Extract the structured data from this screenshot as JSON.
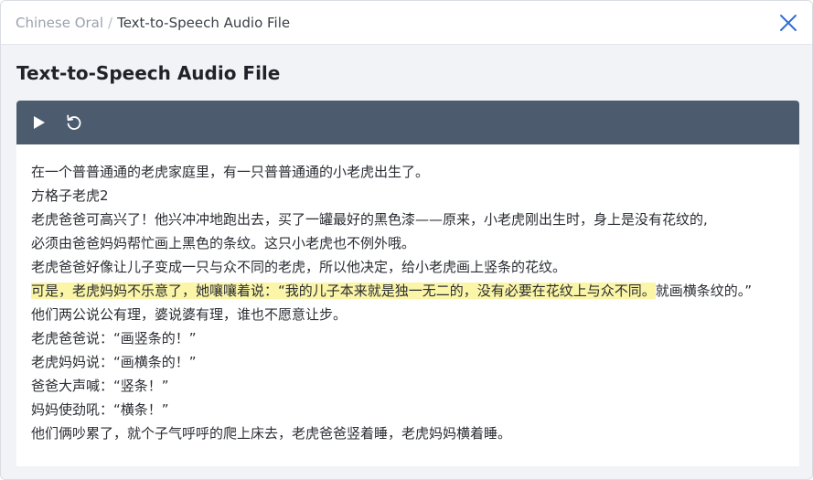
{
  "breadcrumb": {
    "parent": "Chinese Oral",
    "separator": "/",
    "current": "Text-to-Speech Audio File"
  },
  "title": "Text-to-Speech Audio File",
  "player": {
    "play_icon": "play-icon",
    "replay_icon": "replay-icon",
    "bar_color": "#4d5b6e"
  },
  "icons": {
    "close": "close-icon"
  },
  "colors": {
    "accent": "#2f6fd6",
    "highlight": "#fbf5a8"
  },
  "story": {
    "l1": "在一个普普通通的老虎家庭里，有一只普普通通的小老虎出生了。",
    "l2": "方格子老虎2",
    "l3a": "老虎爸爸可高兴了！他兴冲冲地跑出去，买了一罐最好的黑色漆——原来，小老虎刚出生时，身上是没有花纹的,",
    "l3b": "必须由爸爸妈妈帮忙画上黑色的条纹。这只小老虎也不例外哦。",
    "l4": "老虎爸爸好像让儿子变成一只与众不同的老虎，所以他决定，给小老虎画上竖条的花纹。",
    "l5_highlight": "可是，老虎妈妈不乐意了，她嚷嚷着说：“我的儿子本来就是独一无二的，没有必要在花纹上与众不同。",
    "l5_rest": "就画横条纹的。”",
    "l6": "他们两公说公有理，婆说婆有理，谁也不愿意让步。",
    "l7": "老虎爸爸说：“画竖条的！”",
    "l8": "老虎妈妈说：“画横条的！”",
    "l9": "爸爸大声喊：“竖条！”",
    "l10": "妈妈使劲吼：“横条！”",
    "l11": "他们俩吵累了，就个子气呼呼的爬上床去，老虎爸爸竖着睡，老虎妈妈横着睡。"
  }
}
